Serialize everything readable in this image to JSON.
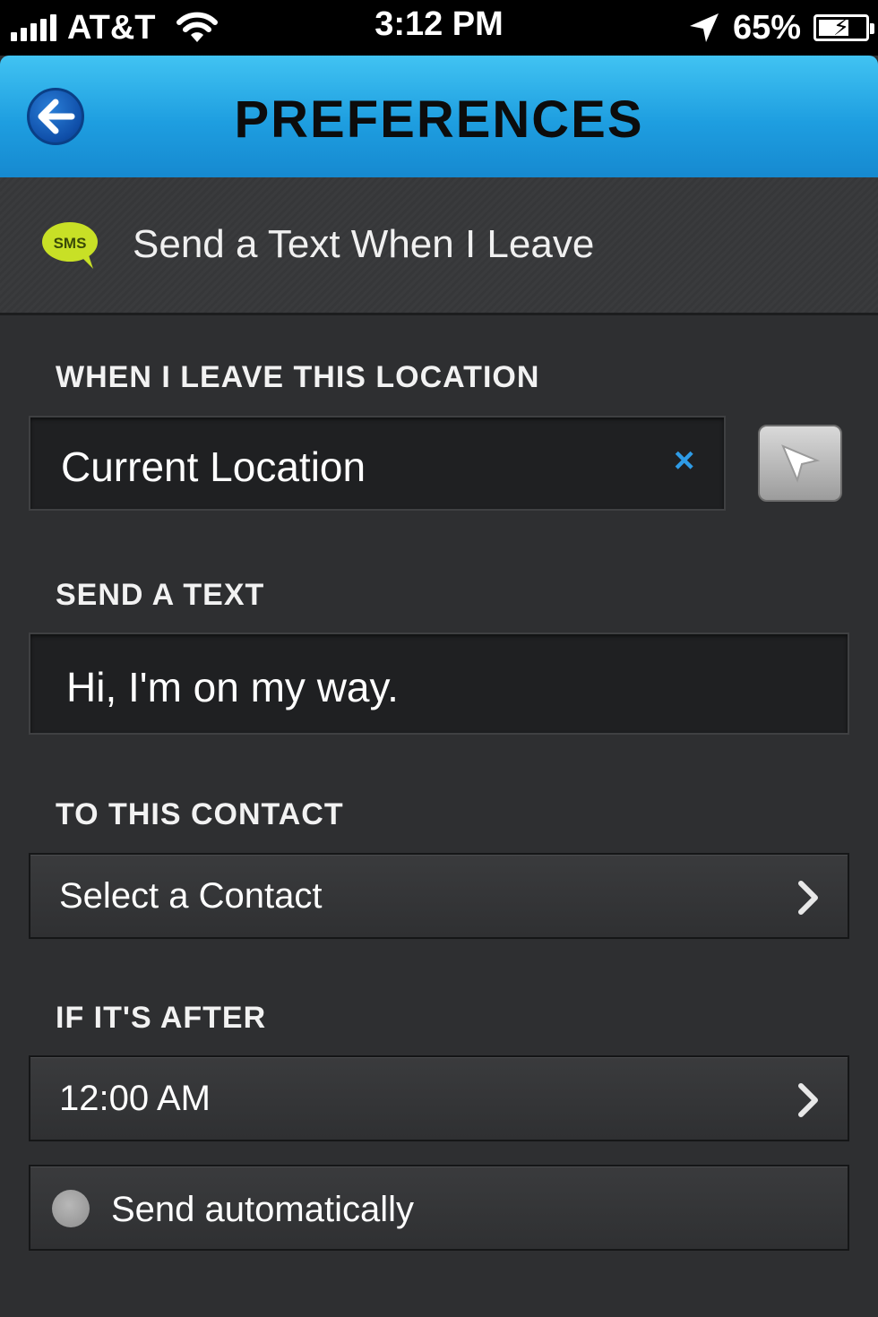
{
  "status_bar": {
    "carrier": "AT&T",
    "time": "3:12 PM",
    "battery_percent": "65%",
    "battery_level": 0.65,
    "signal_icon": "signal-bars-icon",
    "wifi_icon": "wifi-icon",
    "location_icon": "location-arrow-icon",
    "battery_icon": "battery-charging-icon"
  },
  "nav": {
    "title": "PREFERENCES",
    "back_icon": "back-arrow-icon"
  },
  "header": {
    "icon_text": "SMS",
    "title": "Send a Text When I Leave"
  },
  "location_section": {
    "label": "WHEN I LEAVE THIS LOCATION",
    "value": "Current Location",
    "clear_glyph": "×"
  },
  "text_section": {
    "label": "SEND A TEXT",
    "value": "Hi, I'm on my way."
  },
  "contact_section": {
    "label": "TO THIS CONTACT",
    "value": "Select a Contact"
  },
  "time_section": {
    "label": "IF IT'S AFTER",
    "value": "12:00 AM"
  },
  "auto_send": {
    "label": "Send automatically"
  },
  "colors": {
    "accent_blue": "#1e9ee0",
    "sms_green": "#c8e026",
    "background": "#2e2f31"
  }
}
